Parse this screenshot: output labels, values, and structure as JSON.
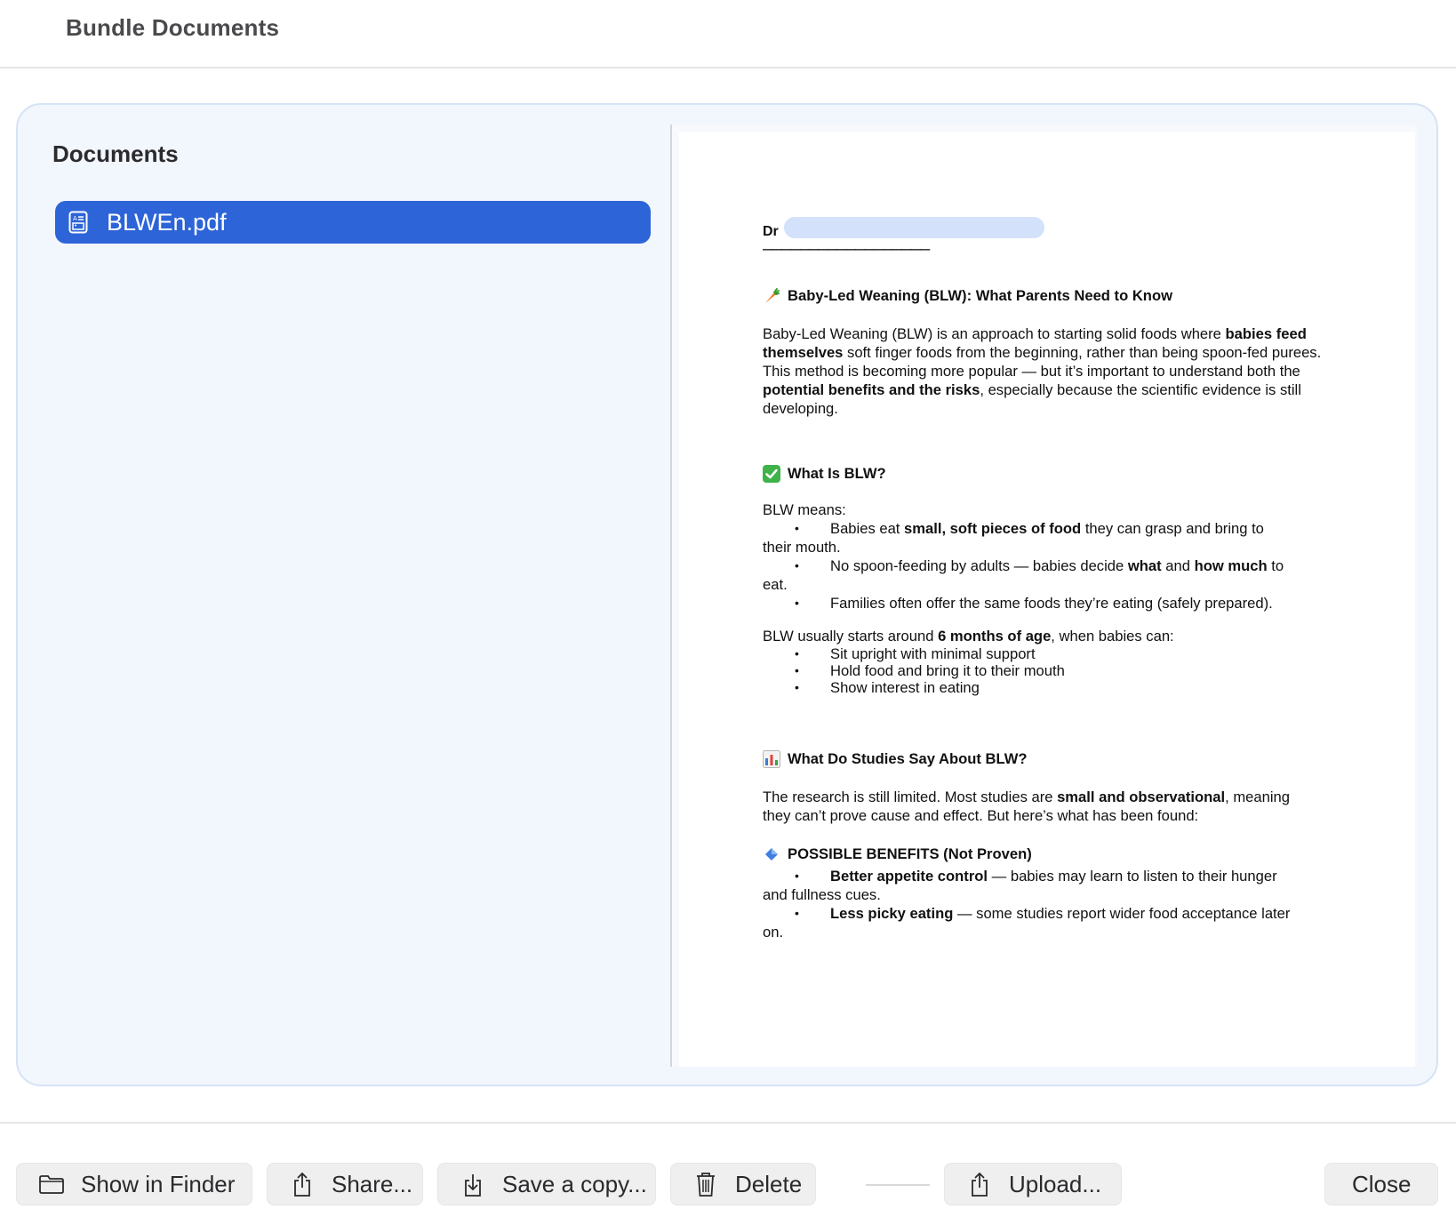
{
  "window": {
    "title": "Bundle Documents"
  },
  "sidebar": {
    "heading": "Documents",
    "items": [
      {
        "label": "BLWEn.pdf",
        "icon": "document-icon",
        "selected": true
      }
    ]
  },
  "preview": {
    "dr_prefix": "Dr",
    "dashes": "——————————————————",
    "title": "Baby-Led Weaning (BLW): What Parents Need to Know",
    "intro": {
      "t1": "Baby-Led Weaning (BLW) is an approach to starting solid foods where ",
      "b1": "babies feed themselves",
      "t2": " soft finger foods from the beginning, rather than being spoon-fed purees. This method is becoming more popular — but it’s important to understand both the ",
      "b2": "potential benefits and the risks",
      "t3": ", especially because the scientific evidence is still developing."
    },
    "section1": {
      "heading": "What Is BLW?",
      "lead": "BLW means:",
      "b1": {
        "t1": "Babies eat ",
        "b1": "small, soft pieces of food",
        "t2": " they can grasp and bring to",
        "cont": "their mouth."
      },
      "b2": {
        "t1": "No spoon-feeding by adults — babies decide ",
        "b1": "what",
        "t2": " and ",
        "b2": "how much",
        "t3": " to",
        "cont": "eat."
      },
      "b3": "Families often offer the same foods they’re eating (safely prepared).",
      "starts": {
        "t1": "BLW usually starts around ",
        "b1": "6 months of age",
        "t2": ", when babies can:"
      },
      "can": [
        "Sit upright with minimal support",
        "Hold food and bring it to their mouth",
        "Show interest in eating"
      ]
    },
    "section2": {
      "heading": "What Do Studies Say About BLW?",
      "p": {
        "t1": "The research is still limited. Most studies are ",
        "b1": "small and observational",
        "t2": ", meaning",
        "line2": "they can’t prove cause and effect. But here’s what has been found:"
      },
      "benefits_heading": "POSSIBLE BENEFITS (Not Proven)",
      "benefit1": {
        "b": "Better appetite control",
        "t": " — babies may learn to listen to their hunger",
        "cont": "and fullness cues."
      },
      "benefit2": {
        "b": "Less picky eating",
        "t": " — some studies report wider food acceptance later",
        "cont": "on."
      }
    }
  },
  "footer": {
    "show_in_finder": "Show in Finder",
    "share": "Share...",
    "save_copy": "Save a copy...",
    "delete": "Delete",
    "upload": "Upload...",
    "close": "Close"
  },
  "colors": {
    "accent": "#2d64d8",
    "panel_bg": "#f2f6fd",
    "redaction": "#d4e1fb"
  }
}
